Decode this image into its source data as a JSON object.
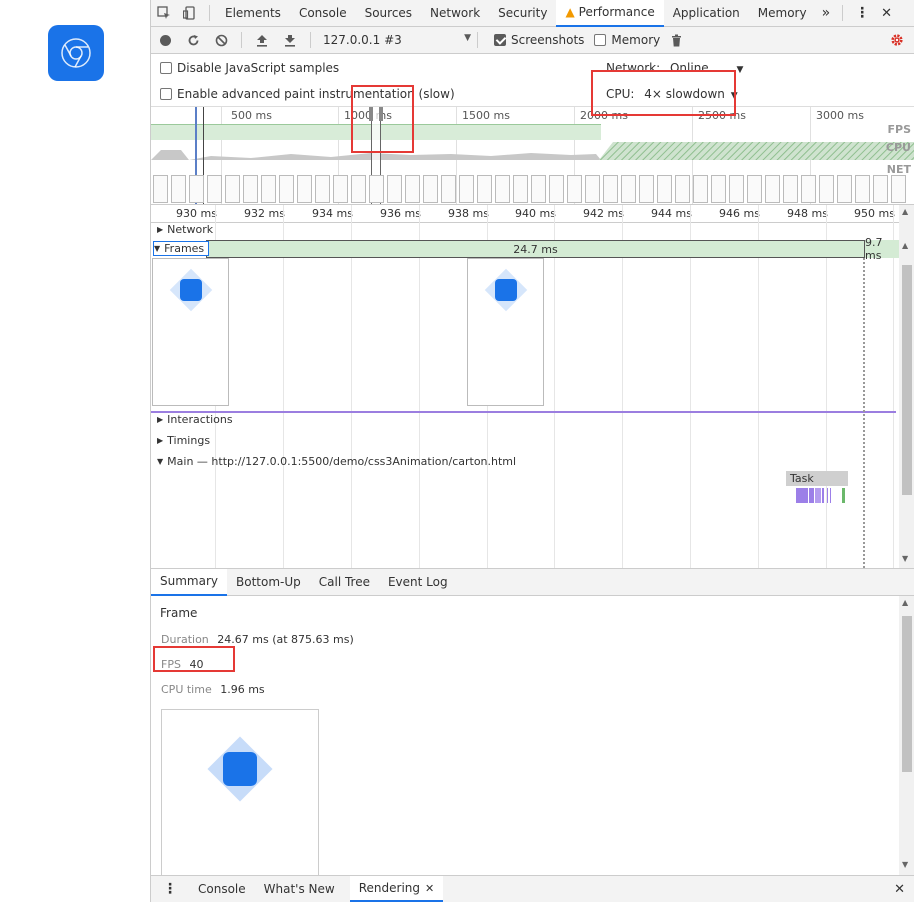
{
  "tabs": {
    "items": [
      "Elements",
      "Console",
      "Sources",
      "Network",
      "Security",
      "Performance",
      "Application",
      "Memory"
    ],
    "more": "»",
    "menu": "⋮",
    "close": "✕"
  },
  "toolbar": {
    "target": "127.0.0.1 #3",
    "screenshots": "Screenshots",
    "memory": "Memory"
  },
  "settings": {
    "disable_js": "Disable JavaScript samples",
    "enable_paint": "Enable advanced paint instrumentation (slow)",
    "network_label": "Network:",
    "network_value": "Online",
    "cpu_label": "CPU:",
    "cpu_value": "4× slowdown"
  },
  "overview": {
    "ticks": [
      "500 ms",
      "1000 ms",
      "1500 ms",
      "2000 ms",
      "2500 ms",
      "3000 ms"
    ],
    "labels": [
      "FPS",
      "CPU",
      "NET"
    ]
  },
  "ruler": {
    "ticks": [
      "930 ms",
      "932 ms",
      "934 ms",
      "936 ms",
      "938 ms",
      "940 ms",
      "942 ms",
      "944 ms",
      "946 ms",
      "948 ms",
      "950 ms"
    ]
  },
  "tracks": {
    "network": "Network",
    "frames": "Frames",
    "frame_duration": "24.7 ms",
    "frame_next": "9.7 ms",
    "interactions": "Interactions",
    "timings": "Timings",
    "main": "Main — http://127.0.0.1:5500/demo/css3Animation/carton.html",
    "task": "Task"
  },
  "bottom_tabs": [
    "Summary",
    "Bottom-Up",
    "Call Tree",
    "Event Log"
  ],
  "summary": {
    "title": "Frame",
    "duration_key": "Duration",
    "duration_val": "24.67 ms (at 875.63 ms)",
    "fps_key": "FPS",
    "fps_val": "40",
    "cpu_key": "CPU time",
    "cpu_val": "1.96 ms"
  },
  "drawer": {
    "tabs": [
      "Console",
      "What's New",
      "Rendering"
    ],
    "rendering_close": "✕",
    "close": "✕"
  },
  "colors": {
    "accent": "#1a73e8",
    "highlight": "#e53935",
    "fps_green": "#d4ebd4",
    "interaction_purple": "#9b7ee0"
  }
}
